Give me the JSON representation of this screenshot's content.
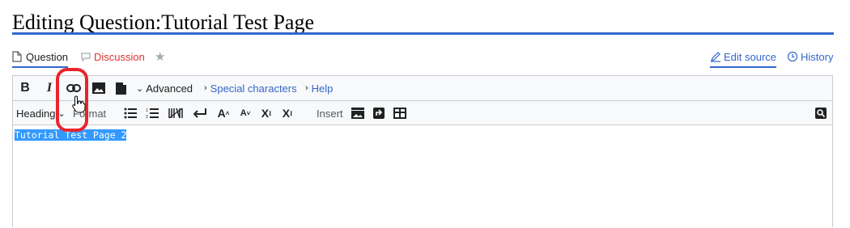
{
  "page": {
    "title": "Editing Question:Tutorial Test Page"
  },
  "tabs": {
    "question": "Question",
    "discussion": "Discussion",
    "edit_source": "Edit source",
    "history": "History"
  },
  "toolbar": {
    "bold": "B",
    "italic": "I",
    "advanced": "Advanced",
    "special_characters": "Special characters",
    "help": "Help",
    "heading": "Heading",
    "format": "Format",
    "big": "A",
    "small": "A",
    "superscript": "X",
    "subscript": "X",
    "insert": "Insert"
  },
  "editor": {
    "content": "Tutorial Test Page 2"
  },
  "colors": {
    "accent": "#3366cc",
    "discussion": "#d33",
    "highlight": "#e8252b",
    "selection": "#3399ff"
  }
}
